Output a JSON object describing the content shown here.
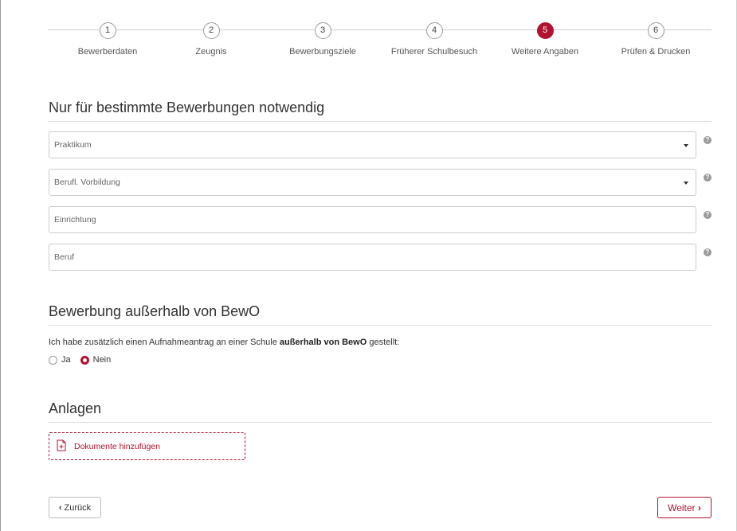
{
  "stepper": {
    "steps": [
      {
        "number": "1",
        "label": "Bewerberdaten"
      },
      {
        "number": "2",
        "label": "Zeugnis"
      },
      {
        "number": "3",
        "label": "Bewerbungsziele"
      },
      {
        "number": "4",
        "label": "Früherer Schulbesuch"
      },
      {
        "number": "5",
        "label": "Weitere Angaben"
      },
      {
        "number": "6",
        "label": "Prüfen & Drucken"
      }
    ],
    "active_step": "5"
  },
  "section_required": {
    "title": "Nur für bestimmte Bewerbungen notwendig",
    "fields": [
      {
        "label": "Praktikum",
        "type": "select"
      },
      {
        "label": "Berufl. Vorbildung",
        "type": "select"
      },
      {
        "label": "Einrichtung",
        "type": "text"
      },
      {
        "label": "Beruf",
        "type": "text"
      }
    ],
    "help_icon": "?"
  },
  "section_external": {
    "title": "Bewerbung außerhalb von BewO",
    "question_prefix": "Ich habe zusätzlich einen Aufnahmeantrag an einer Schule ",
    "question_bold": "außerhalb von BewO",
    "question_suffix": " gestellt:",
    "options": [
      {
        "label": "Ja",
        "checked": false
      },
      {
        "label": "Nein",
        "checked": true
      }
    ]
  },
  "section_attachments": {
    "title": "Anlagen",
    "upload_label": "Dokumente hinzufügen"
  },
  "navigation": {
    "back_label": "Zurück",
    "next_label": "Weiter",
    "back_chevron": "‹",
    "next_chevron": "›"
  },
  "colors": {
    "accent": "#b0122f",
    "border": "#cccccc"
  }
}
